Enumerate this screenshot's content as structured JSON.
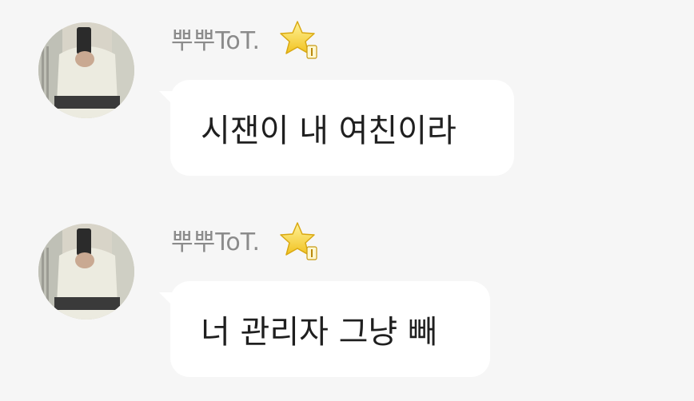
{
  "messages": [
    {
      "sender": "뿌뿌ToT.",
      "badge_icon": "star-badge-icon",
      "text": "시잰이 내 여친이라"
    },
    {
      "sender": "뿌뿌ToT.",
      "badge_icon": "star-badge-icon",
      "text": "너 관리자 그냥 빼"
    }
  ],
  "colors": {
    "background": "#f6f6f6",
    "bubble": "#ffffff",
    "sender_text": "#8b8b8b",
    "message_text": "#1f1f1f",
    "star": "#f5d53a"
  }
}
